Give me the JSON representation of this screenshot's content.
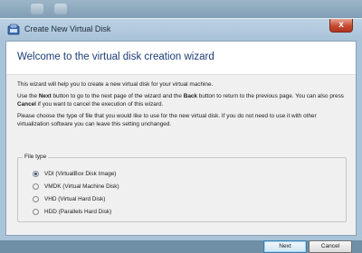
{
  "window": {
    "title": "Create New Virtual Disk",
    "close_glyph": "x"
  },
  "wizard": {
    "heading": "Welcome to the virtual disk creation wizard",
    "intro": "This wizard will help you to create a new virtual disk for your virtual machine.",
    "nav_text": {
      "p1": "Use the ",
      "next_word": "Next",
      "p2": " button to go to the next page of the wizard and the ",
      "back_word": "Back",
      "p3": " button to return to the previous page. You can also press ",
      "cancel_word": "Cancel",
      "p4": " if you want to cancel the execution of this wizard."
    },
    "choose_text": "Please choose the type of file that you would like to use for the new virtual disk. If you do not need to use it with other virtualization software you can leave this setting unchanged."
  },
  "file_type": {
    "legend": "File type",
    "selected": "VDI (VirtualBox Disk Image)",
    "options": [
      "VDI (VirtualBox Disk Image)",
      "VMDK (Virtual Machine Disk)",
      "VHD (Virtual Hard Disk)",
      "HDD (Parallels Hard Disk)"
    ]
  },
  "buttons": {
    "next": "Next",
    "cancel": "Cancel"
  }
}
